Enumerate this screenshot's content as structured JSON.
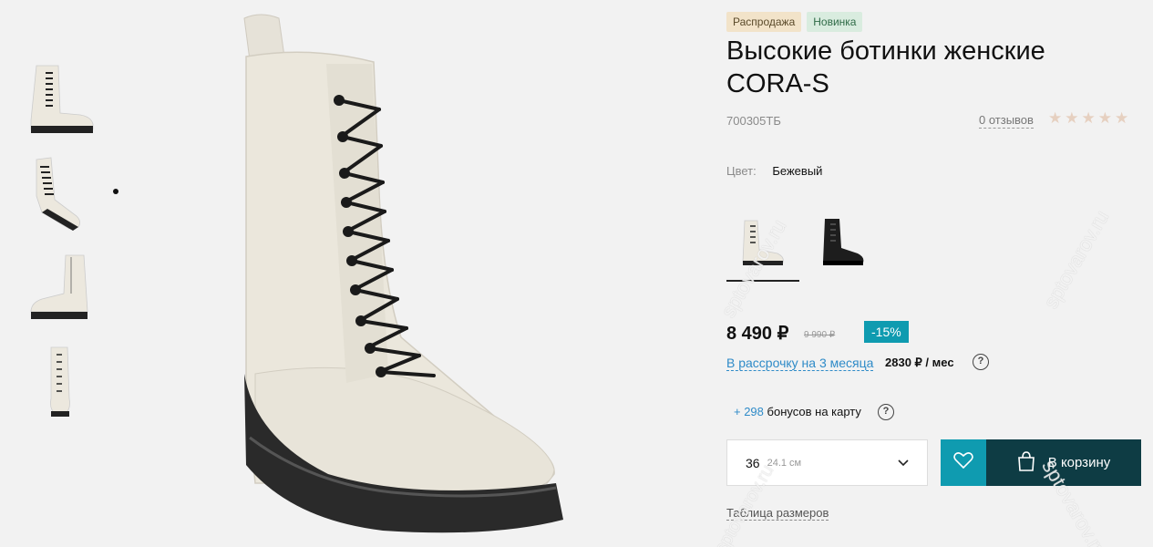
{
  "badges": {
    "sale": "Распродажа",
    "new": "Новинка"
  },
  "product": {
    "title": "Высокие ботинки женские CORA-S",
    "sku": "700305ТБ",
    "reviews": "0 отзывов",
    "rating": 0
  },
  "color": {
    "label": "Цвет:",
    "value": "Бежевый"
  },
  "price": {
    "current": "8 490 ₽",
    "old": "9 990 ₽",
    "discount": "-15%"
  },
  "installment": {
    "link": "В рассрочку на 3 месяца",
    "amount": "2830 ₽ / мес"
  },
  "bonus": {
    "amount": "+ 298",
    "text": "бонусов на карту"
  },
  "size": {
    "value": "36",
    "cm": "24.1 см"
  },
  "cart": {
    "label": "В корзину"
  },
  "size_table": "Таблица размеров",
  "help": "?",
  "watermark": "sptovarov.ru",
  "colors": {
    "accent": "#0f9bb0",
    "cart": "#0e3c44",
    "link": "#2f8bc8"
  }
}
